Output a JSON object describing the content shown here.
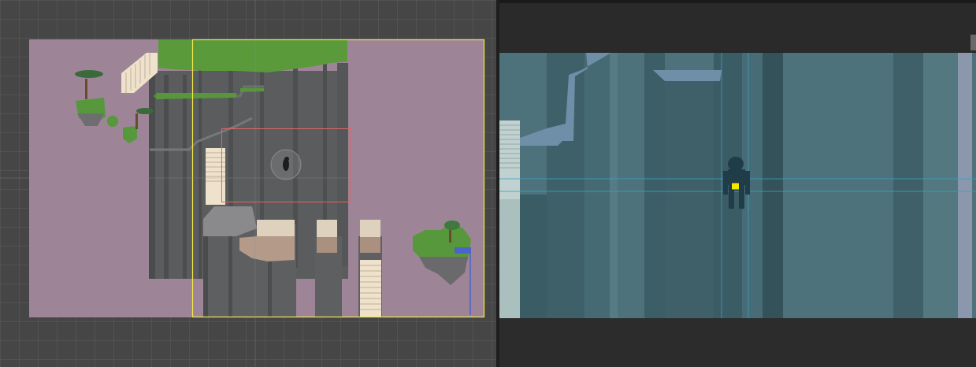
{
  "scene_view": {
    "background_color": "#464646",
    "world_background_color": "#9e8497",
    "camera_bounds_color": "#f3e84a",
    "focus_rect_color": "#e16565",
    "cliff_color": "#5d5e60",
    "grass_color": "#58963b"
  },
  "game_view": {
    "background_color": "#4d727b",
    "guide_line_color": "#3aa0c9",
    "player_marker_color": "#f5e600",
    "player_color": "#1f3c48"
  },
  "icons": [
    "player-character-icon",
    "tree-icon",
    "staircase-icon",
    "floating-island-icon",
    "crosshair-guide-icon"
  ]
}
